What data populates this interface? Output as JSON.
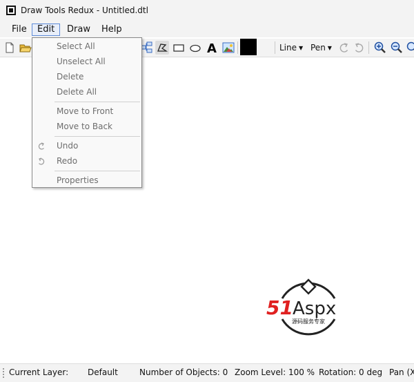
{
  "window": {
    "title": "Draw Tools Redux - Untitled.dtl"
  },
  "menubar": {
    "items": [
      "File",
      "Edit",
      "Draw",
      "Help"
    ]
  },
  "edit_menu": {
    "items": [
      {
        "label": "Select All"
      },
      {
        "label": "Unselect All"
      },
      {
        "label": "Delete"
      },
      {
        "label": "Delete All"
      },
      {
        "label": "Move to Front"
      },
      {
        "label": "Move to Back"
      },
      {
        "label": "Undo",
        "icon": "undo-icon"
      },
      {
        "label": "Redo",
        "icon": "redo-icon"
      },
      {
        "label": "Properties"
      }
    ]
  },
  "toolbar": {
    "text_tool_glyph": "A",
    "line_dropdown": "Line",
    "pen_dropdown": "Pen",
    "current_color": "#000000",
    "icons": [
      "new-file-icon",
      "open-folder-icon",
      "connector-tool-icon",
      "polygon-tool-icon",
      "rectangle-tool-icon",
      "ellipse-tool-icon",
      "text-tool-icon",
      "image-tool-icon",
      "undo-icon",
      "redo-icon",
      "zoom-in-icon",
      "zoom-out-icon",
      "zoom-reset-icon"
    ]
  },
  "statusbar": {
    "layer_label": "Current Layer:",
    "layer_value": "Default",
    "objects": "Number of Objects:  0",
    "zoom": "Zoom Level:  100 %",
    "rotation": "Rotation:  0 deg",
    "pan": "Pan  (X"
  },
  "watermark": {
    "brand_51": "51",
    "brand_aspx": "Aspx",
    "tagline": "源码服务专家"
  }
}
